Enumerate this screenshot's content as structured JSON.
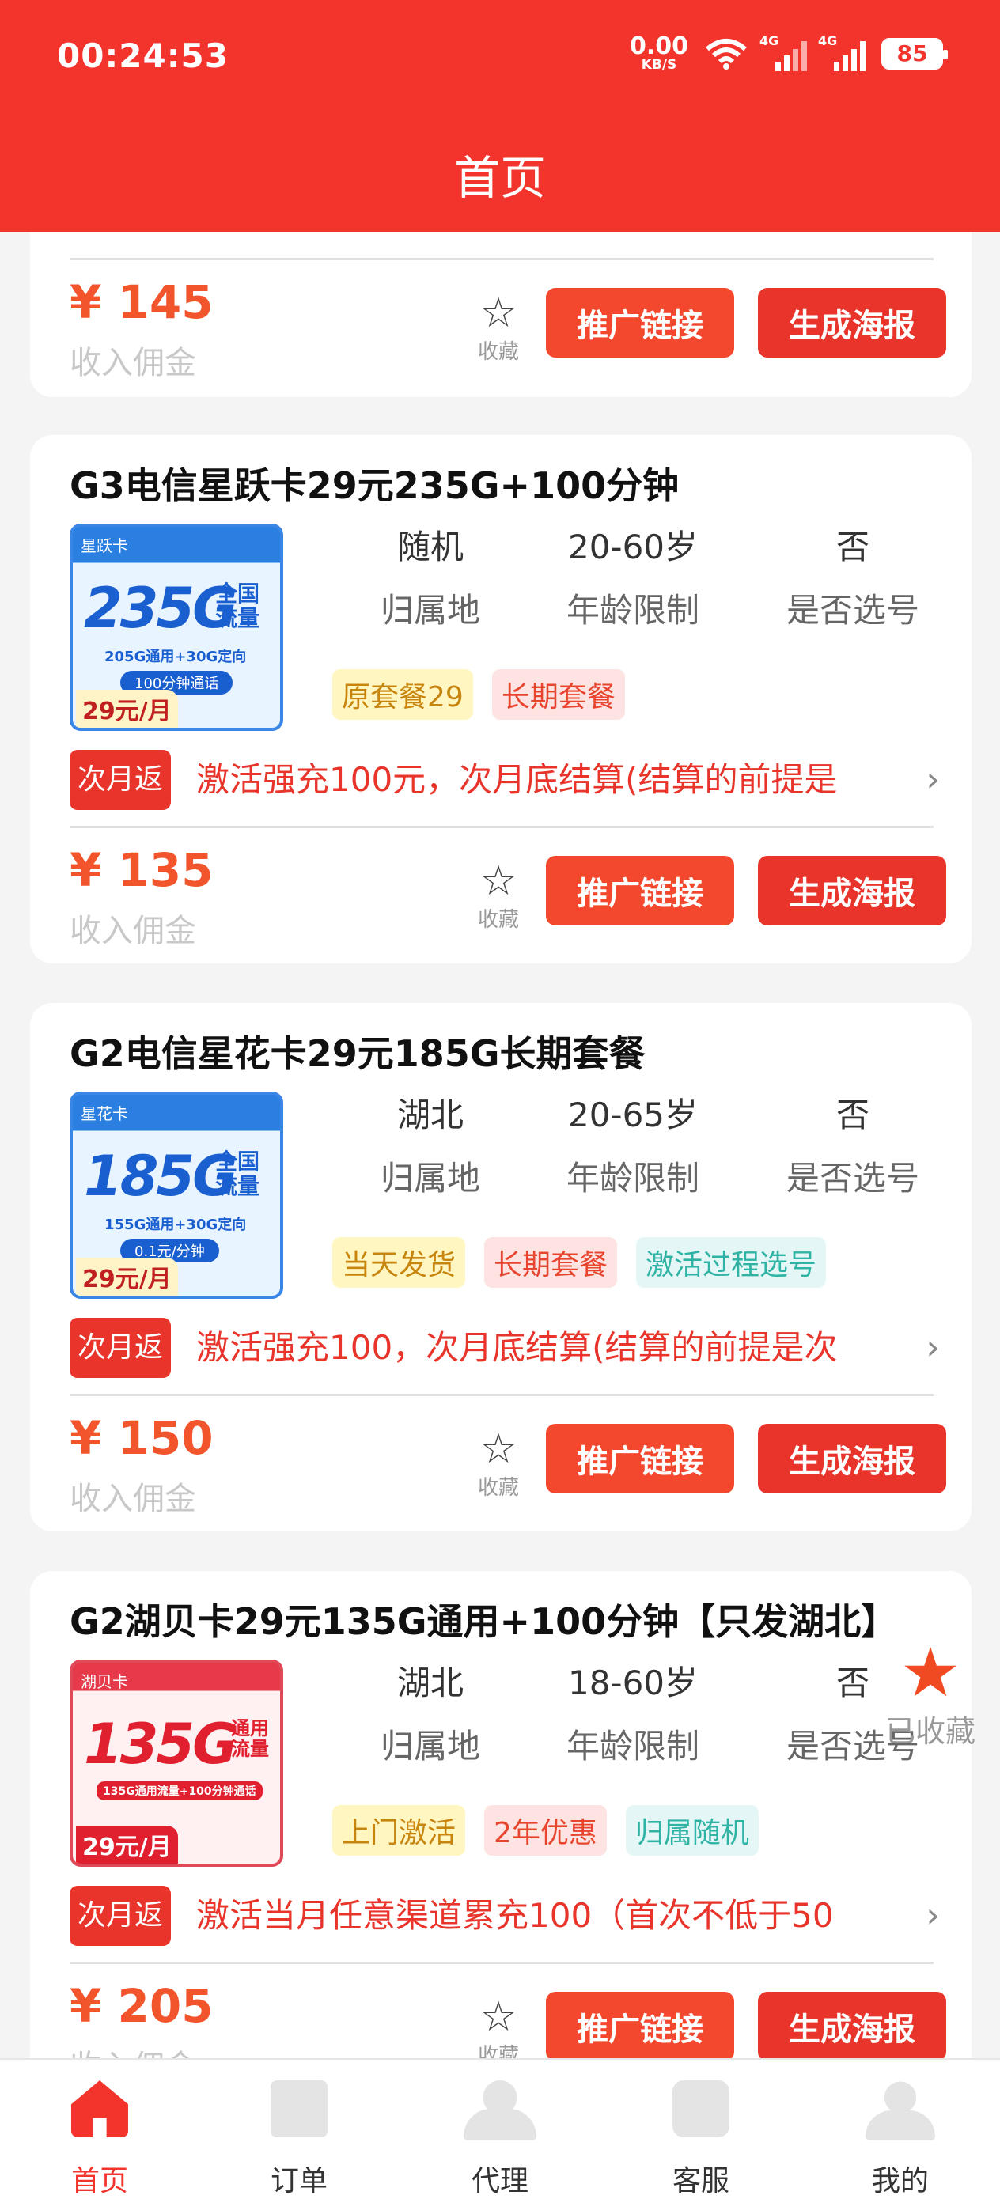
{
  "status_bar": {
    "time": "00:24:53",
    "net_speed_value": "0.00",
    "net_speed_unit": "KB/S",
    "signal_1": "4G",
    "signal_2": "4G",
    "battery": "85"
  },
  "header": {
    "title": "首页"
  },
  "fav_label": "收藏",
  "collected_label": "已收藏",
  "first_card": {
    "price": "¥ 145",
    "commission_label": "收入佣金",
    "promo_button": "推广链接",
    "poster_button": "生成海报"
  },
  "products": [
    {
      "title": "G3电信星跃卡29元235G+100分钟",
      "thumb": {
        "head": "星跃卡",
        "big": "235G",
        "side1": "全国",
        "side2": "流量",
        "sub": "205G通用+30G定向",
        "pill": "100分钟通话",
        "price": "29元/月"
      },
      "region_value": "随机",
      "region_label": "归属地",
      "age_value": "20-60岁",
      "age_label": "年龄限制",
      "select_value": "否",
      "select_label": "是否选号",
      "tags": [
        "原套餐29",
        "长期套餐"
      ],
      "rebate_badge": "次月返",
      "rebate_text": "激活强充100元，次月底结算(结算的前提是",
      "price": "¥ 135",
      "commission_label": "收入佣金",
      "promo_button": "推广链接",
      "poster_button": "生成海报"
    },
    {
      "title": "G2电信星花卡29元185G长期套餐",
      "thumb": {
        "head": "星花卡",
        "big": "185G",
        "side1": "全国",
        "side2": "流量",
        "sub": "155G通用+30G定向",
        "pill": "0.1元/分钟",
        "price": "29元/月"
      },
      "region_value": "湖北",
      "region_label": "归属地",
      "age_value": "20-65岁",
      "age_label": "年龄限制",
      "select_value": "否",
      "select_label": "是否选号",
      "tags": [
        "当天发货",
        "长期套餐",
        "激活过程选号"
      ],
      "rebate_badge": "次月返",
      "rebate_text": "激活强充100，次月底结算(结算的前提是次",
      "price": "¥ 150",
      "commission_label": "收入佣金",
      "promo_button": "推广链接",
      "poster_button": "生成海报"
    },
    {
      "title": "G2湖贝卡29元135G通用+100分钟【只发湖北】",
      "thumb": {
        "head": "湖贝卡",
        "big": "135G",
        "side1": "通用",
        "side2": "流量",
        "sub": "135G通用流量+100分钟通话",
        "pill": "",
        "price": "29元/月"
      },
      "region_value": "湖北",
      "region_label": "归属地",
      "age_value": "18-60岁",
      "age_label": "年龄限制",
      "select_value": "否",
      "select_label": "是否选号",
      "tags": [
        "上门激活",
        "2年优惠",
        "归属随机"
      ],
      "rebate_badge": "次月返",
      "rebate_text": "激活当月任意渠道累充100（首次不低于50",
      "price": "¥ 205",
      "commission_label": "收入佣金",
      "promo_button": "推广链接",
      "poster_button": "生成海报"
    }
  ],
  "bottom_nav": [
    {
      "label": "首页",
      "icon": "home-icon"
    },
    {
      "label": "订单",
      "icon": "order-icon"
    },
    {
      "label": "代理",
      "icon": "agent-icon"
    },
    {
      "label": "客服",
      "icon": "chat-icon"
    },
    {
      "label": "我的",
      "icon": "user-icon"
    }
  ]
}
